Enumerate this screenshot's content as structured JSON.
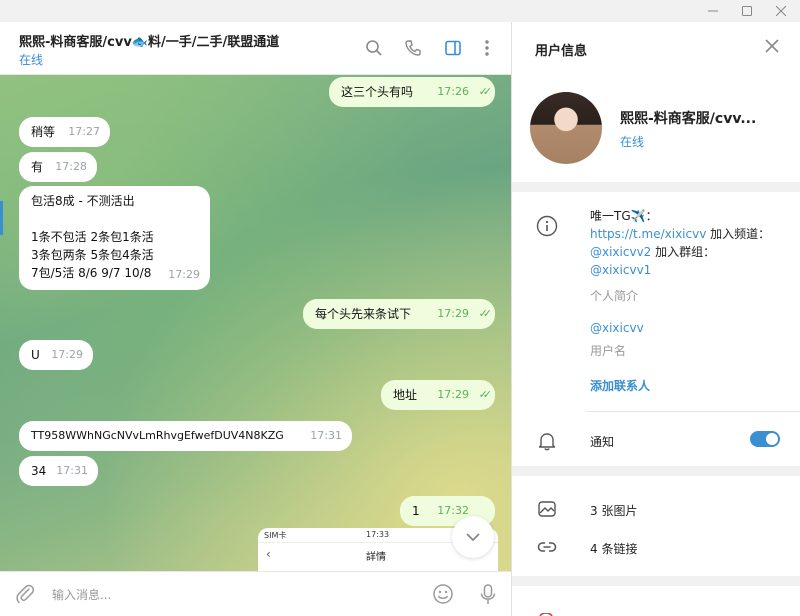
{
  "chat": {
    "title": "熙熙-料商客服/cvv🐟料/一手/二手/联盟通道",
    "status": "在线"
  },
  "messages": [
    {
      "dir": "out",
      "text": "这三个头有吗",
      "time": "17:26"
    },
    {
      "dir": "in",
      "text": "稍等",
      "time": "17:27"
    },
    {
      "dir": "in",
      "text": "有",
      "time": "17:28"
    },
    {
      "dir": "in",
      "lines": [
        "包活8成 - 不测活出",
        "",
        "1条不包活  2条包1条活",
        "3条包两条  5条包4条活",
        "7包/5活  8/6  9/7  10/8"
      ],
      "time": "17:29"
    },
    {
      "dir": "out",
      "text": "每个头先来条试下",
      "time": "17:29"
    },
    {
      "dir": "in",
      "text": "U",
      "time": "17:29"
    },
    {
      "dir": "out",
      "text": "地址",
      "time": "17:29"
    },
    {
      "dir": "in",
      "text": "TT958WWhNGcNVvLmRhvgEfwefDUV4N8KZG",
      "time": "17:31"
    },
    {
      "dir": "in",
      "text": "34",
      "time": "17:31"
    },
    {
      "dir": "out",
      "text": "1",
      "time": "17:32"
    }
  ],
  "screenshot": {
    "carrier": "SIM卡",
    "clock": "17:33",
    "title": "詳情"
  },
  "composer": {
    "placeholder": "输入消息..."
  },
  "panel": {
    "title": "用户信息",
    "name": "熙熙-料商客服/cvv...",
    "status": "在线",
    "bio_prefix": "唯一TG✈️：",
    "bio_link1": "https://t.me/xixicvv",
    "bio_mid1": " 加入频道：",
    "bio_link2": "@xixicvv2",
    "bio_mid2": " 加入群组：",
    "bio_link3": "@xixicvv1",
    "bio_label": "个人简介",
    "username": "@xixicvv",
    "username_label": "用户名",
    "add_contact": "添加联系人",
    "notifications": "通知",
    "notifications_on": true,
    "photos": "3 张图片",
    "links": "4 条链接"
  },
  "colors": {
    "accent": "#3a8fd3",
    "outgoing": "#effdde",
    "incoming": "#ffffff",
    "check": "#5fae59"
  }
}
